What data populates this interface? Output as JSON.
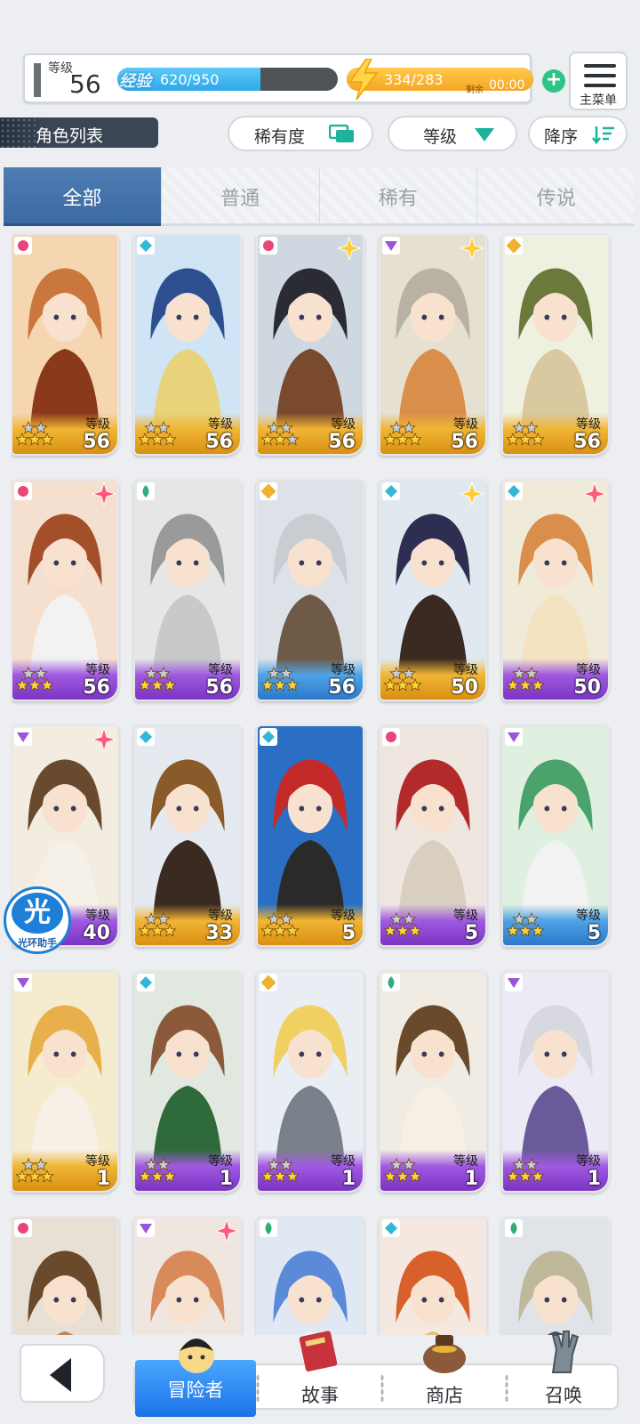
{
  "status": {
    "level_label": "等级",
    "level_value": "56",
    "exp_tag": "经验",
    "exp_text": "620/950",
    "exp_progress": 0.65,
    "stamina_text": "334/283",
    "stamina_progress": 1.0,
    "remain_label": "剩余",
    "remain_value": "00:00"
  },
  "main_menu": {
    "label": "主菜单"
  },
  "filter": {
    "list_title": "角色列表",
    "rarity_label": "稀有度",
    "level_label": "等级",
    "sort_label": "降序"
  },
  "tabs": [
    {
      "label": "全部",
      "active": true
    },
    {
      "label": "普通",
      "active": false
    },
    {
      "label": "稀有",
      "active": false
    },
    {
      "label": "传说",
      "active": false
    }
  ],
  "card_level_label": "等级",
  "cards": [
    {
      "level": "56",
      "frame": "gold",
      "element": "fire",
      "stars": 3,
      "sparkle": false
    },
    {
      "level": "56",
      "frame": "gold",
      "element": "water",
      "stars": 3,
      "sparkle": false
    },
    {
      "level": "56",
      "frame": "gold",
      "element": "fire",
      "stars": 2,
      "sparkle": true
    },
    {
      "level": "56",
      "frame": "gold",
      "element": "dark",
      "stars": 3,
      "sparkle": true
    },
    {
      "level": "56",
      "frame": "gold",
      "element": "light",
      "stars": 3,
      "sparkle": false
    },
    {
      "level": "56",
      "frame": "purple",
      "element": "fire",
      "stars": 3,
      "sparkle": true
    },
    {
      "level": "56",
      "frame": "purple",
      "element": "wind",
      "stars": 3,
      "sparkle": false
    },
    {
      "level": "56",
      "frame": "blue",
      "element": "light",
      "stars": 3,
      "sparkle": false
    },
    {
      "level": "50",
      "frame": "gold",
      "element": "water",
      "stars": 3,
      "sparkle": true
    },
    {
      "level": "50",
      "frame": "purple",
      "element": "water",
      "stars": 3,
      "sparkle": true
    },
    {
      "level": "40",
      "frame": "purple",
      "element": "dark",
      "stars": 3,
      "sparkle": true
    },
    {
      "level": "33",
      "frame": "gold",
      "element": "water",
      "stars": 3,
      "sparkle": false
    },
    {
      "level": "5",
      "frame": "gold",
      "element": "water",
      "stars": 3,
      "sparkle": false
    },
    {
      "level": "5",
      "frame": "purple",
      "element": "fire",
      "stars": 3,
      "sparkle": false
    },
    {
      "level": "5",
      "frame": "blue",
      "element": "dark",
      "stars": 3,
      "sparkle": false
    },
    {
      "level": "1",
      "frame": "gold",
      "element": "dark",
      "stars": 3,
      "sparkle": false
    },
    {
      "level": "1",
      "frame": "purple",
      "element": "water",
      "stars": 3,
      "sparkle": false
    },
    {
      "level": "1",
      "frame": "purple",
      "element": "light",
      "stars": 3,
      "sparkle": false
    },
    {
      "level": "1",
      "frame": "purple",
      "element": "wind",
      "stars": 3,
      "sparkle": false
    },
    {
      "level": "1",
      "frame": "purple",
      "element": "dark",
      "stars": 3,
      "sparkle": false
    },
    {
      "level": "",
      "frame": "none",
      "element": "fire",
      "stars": 0,
      "sparkle": false
    },
    {
      "level": "",
      "frame": "none",
      "element": "dark",
      "stars": 0,
      "sparkle": true
    },
    {
      "level": "",
      "frame": "none",
      "element": "wind",
      "stars": 0,
      "sparkle": false
    },
    {
      "level": "",
      "frame": "none",
      "element": "water",
      "stars": 0,
      "sparkle": false
    },
    {
      "level": "",
      "frame": "none",
      "element": "wind",
      "stars": 0,
      "sparkle": false
    }
  ],
  "helper": {
    "glyph": "光",
    "label": "光环助手"
  },
  "nav": {
    "items": [
      {
        "label": "冒险者",
        "icon": "adventurer-icon",
        "active": true
      },
      {
        "label": "故事",
        "icon": "story-book-icon",
        "active": false
      },
      {
        "label": "商店",
        "icon": "shop-bag-icon",
        "active": false
      },
      {
        "label": "召唤",
        "icon": "summon-hand-icon",
        "active": false
      }
    ]
  },
  "colors": {
    "fire": "#e8457a",
    "water": "#33b6d8",
    "dark": "#9b55d8",
    "light": "#f0b030",
    "wind": "#2fae7a",
    "accent_blue": "#3b6aa2"
  }
}
